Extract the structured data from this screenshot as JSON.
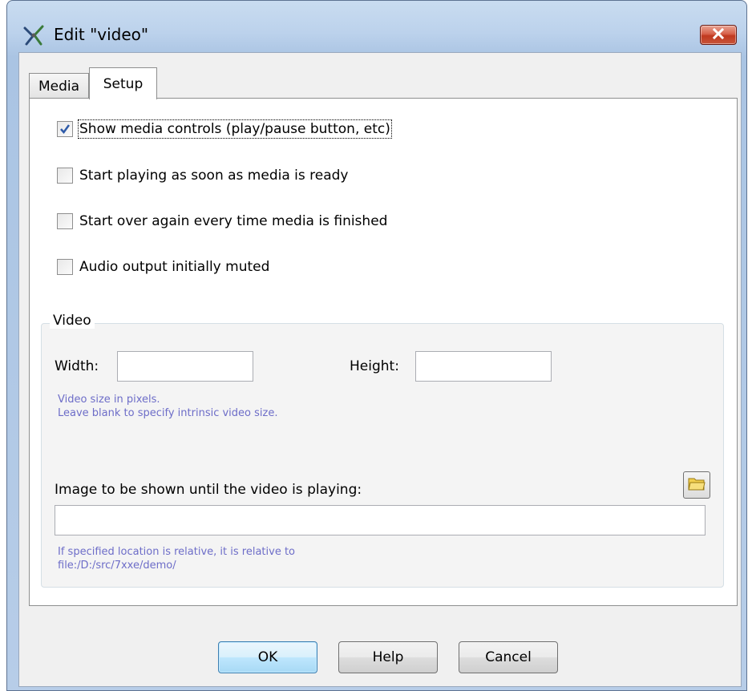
{
  "window": {
    "title": "Edit \"video\"",
    "icons": {
      "app": "edit-tools-icon",
      "close": "close-icon"
    }
  },
  "tabs": [
    {
      "label": "Media",
      "selected": false
    },
    {
      "label": "Setup",
      "selected": true
    }
  ],
  "options": [
    {
      "label": "Show media controls (play/pause button, etc)",
      "checked": true
    },
    {
      "label": "Start playing as soon as media is ready",
      "checked": false
    },
    {
      "label": "Start over again every time media is finished",
      "checked": false
    },
    {
      "label": "Audio output initially muted",
      "checked": false
    }
  ],
  "video": {
    "group_title": "Video",
    "width_label": "Width:",
    "width_value": "",
    "height_label": "Height:",
    "height_value": "",
    "size_hint_1": "Video size in pixels.",
    "size_hint_2": "Leave blank to specify intrinsic video size.",
    "poster_label": "Image to be shown until the video is playing:",
    "poster_value": "",
    "browse_icon": "folder-icon",
    "location_hint_1": "If specified location is relative, it is relative to",
    "location_hint_2": "file:/D:/src/7xxe/demo/"
  },
  "buttons": {
    "ok": "OK",
    "help": "Help",
    "cancel": "Cancel"
  },
  "colors": {
    "hint_text": "#6d6dc8",
    "checkmark": "#2e5aa8",
    "close_button": "#c8553a"
  }
}
